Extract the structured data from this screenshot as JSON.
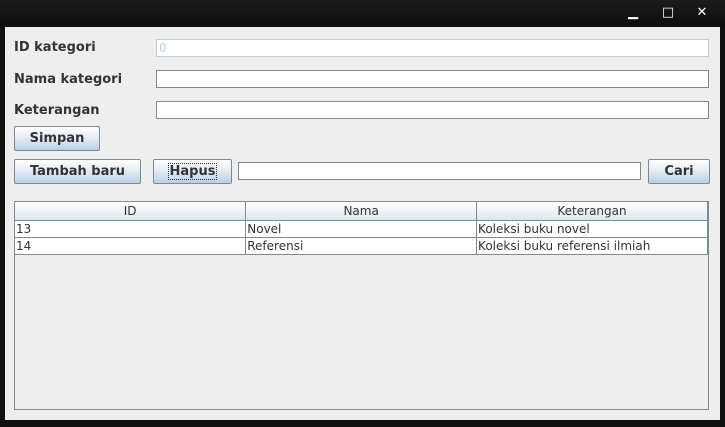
{
  "window": {
    "minimize_icon": "minimize-icon",
    "maximize_icon": "maximize-icon",
    "close_icon": "close-icon",
    "minimize_glyph": "▁",
    "maximize_glyph": "□",
    "close_glyph": "✕"
  },
  "form": {
    "id_label": "ID kategori",
    "id_value": "0",
    "nama_label": "Nama kategori",
    "nama_value": "",
    "keterangan_label": "Keterangan",
    "keterangan_value": ""
  },
  "buttons": {
    "simpan": "Simpan",
    "tambah_baru": "Tambah baru",
    "hapus": "Hapus",
    "cari": "Cari"
  },
  "search": {
    "value": ""
  },
  "table": {
    "columns": [
      "ID",
      "Nama",
      "Keterangan"
    ],
    "rows": [
      [
        "13",
        "Novel",
        "Koleksi buku novel"
      ],
      [
        "14",
        "Referensi",
        "Koleksi buku referensi ilmiah"
      ]
    ]
  },
  "colors": {
    "panel": "#eeeeee",
    "border": "#7a8a99",
    "button_top": "#ffffff",
    "button_bottom": "#b8cfe5",
    "titlebar": "#101010"
  }
}
